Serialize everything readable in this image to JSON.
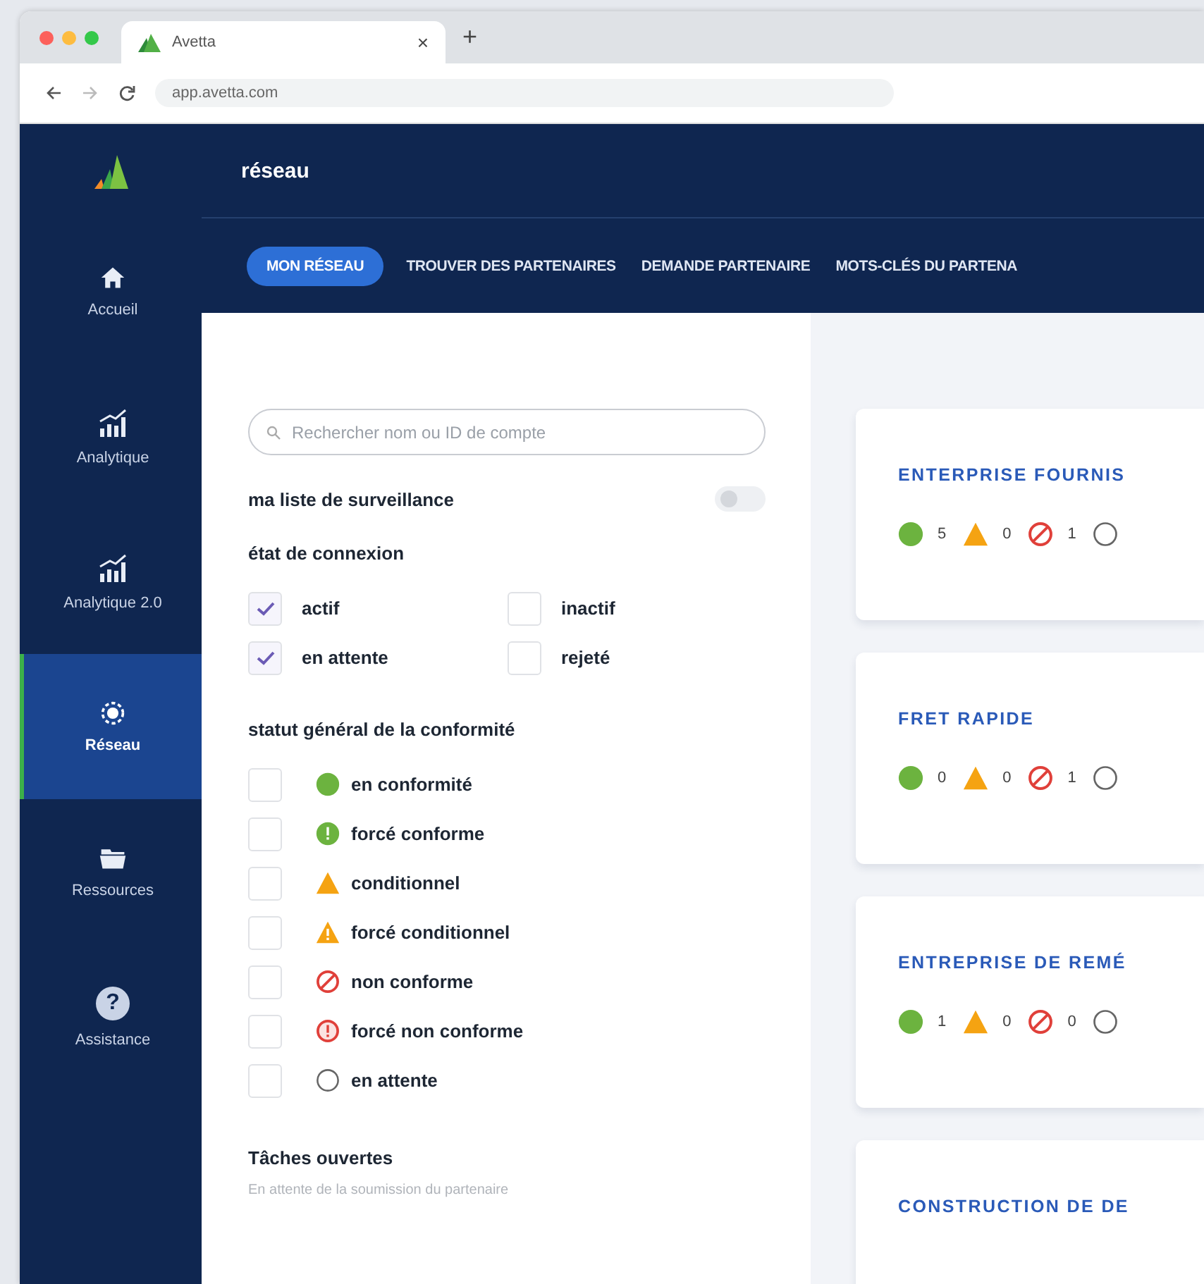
{
  "browser": {
    "tab_title": "Avetta",
    "tab_close": "×",
    "new_tab": "+",
    "address": "app.avetta.com"
  },
  "header": {
    "title": "réseau"
  },
  "nav_tabs": [
    {
      "label": "MON RÉSEAU",
      "selected": true
    },
    {
      "label": "TROUVER DES PARTENAIRES",
      "selected": false
    },
    {
      "label": "DEMANDE PARTENAIRE",
      "selected": false
    },
    {
      "label": "MOTS-CLÉS DU PARTENA",
      "selected": false
    }
  ],
  "sidebar": {
    "items": [
      {
        "kind": "home",
        "label": "Accueil",
        "selected": false
      },
      {
        "kind": "chart",
        "label": "Analytique",
        "selected": false
      },
      {
        "kind": "chart",
        "label": "Analytique 2.0",
        "selected": false
      },
      {
        "kind": "network",
        "label": "Réseau",
        "selected": true
      },
      {
        "kind": "folder",
        "label": "Ressources",
        "selected": false
      },
      {
        "kind": "help",
        "label": "Assistance",
        "selected": false,
        "glyph": "?"
      }
    ]
  },
  "filters": {
    "search": {
      "placeholder": "Rechercher nom ou ID de compte"
    },
    "watchlist": {
      "label": "ma liste de surveillance",
      "on": false
    },
    "connection": {
      "title": "état de connexion",
      "options": [
        {
          "label": "actif",
          "checked": true
        },
        {
          "label": "inactif",
          "checked": false
        },
        {
          "label": "en attente",
          "checked": true
        },
        {
          "label": "rejeté",
          "checked": false
        }
      ]
    },
    "compliance": {
      "title": "statut général de la conformité",
      "options": [
        {
          "kind": "compliant",
          "label": "en conformité",
          "checked": false
        },
        {
          "kind": "forced-compliant",
          "label": "forcé conforme",
          "checked": false
        },
        {
          "kind": "conditional",
          "label": "conditionnel",
          "checked": false
        },
        {
          "kind": "forced-conditional",
          "label": "forcé conditionnel",
          "checked": false
        },
        {
          "kind": "non-compliant",
          "label": "non conforme",
          "checked": false
        },
        {
          "kind": "forced-non-compliant",
          "label": "forcé non conforme",
          "checked": false
        },
        {
          "kind": "pending",
          "label": "en attente",
          "checked": false
        }
      ]
    },
    "tasks": {
      "title": "Tâches ouvertes",
      "subtitle": "En attente de la soumission du partenaire"
    }
  },
  "cards": [
    {
      "title": "ENTERPRISE FOURNIS",
      "stats": [
        {
          "kind": "compliant",
          "count": "5"
        },
        {
          "kind": "conditional",
          "count": "0"
        },
        {
          "kind": "non-compliant",
          "count": "1"
        },
        {
          "kind": "pending"
        }
      ]
    },
    {
      "title": "FRET RAPIDE",
      "stats": [
        {
          "kind": "compliant",
          "count": "0"
        },
        {
          "kind": "conditional",
          "count": "0"
        },
        {
          "kind": "non-compliant",
          "count": "1"
        },
        {
          "kind": "pending"
        }
      ]
    },
    {
      "title": "ENTREPRISE DE REMÉ",
      "stats": [
        {
          "kind": "compliant",
          "count": "1"
        },
        {
          "kind": "conditional",
          "count": "0"
        },
        {
          "kind": "non-compliant",
          "count": "0"
        },
        {
          "kind": "pending"
        }
      ]
    },
    {
      "title": "CONSTRUCTION DE DE"
    }
  ]
}
